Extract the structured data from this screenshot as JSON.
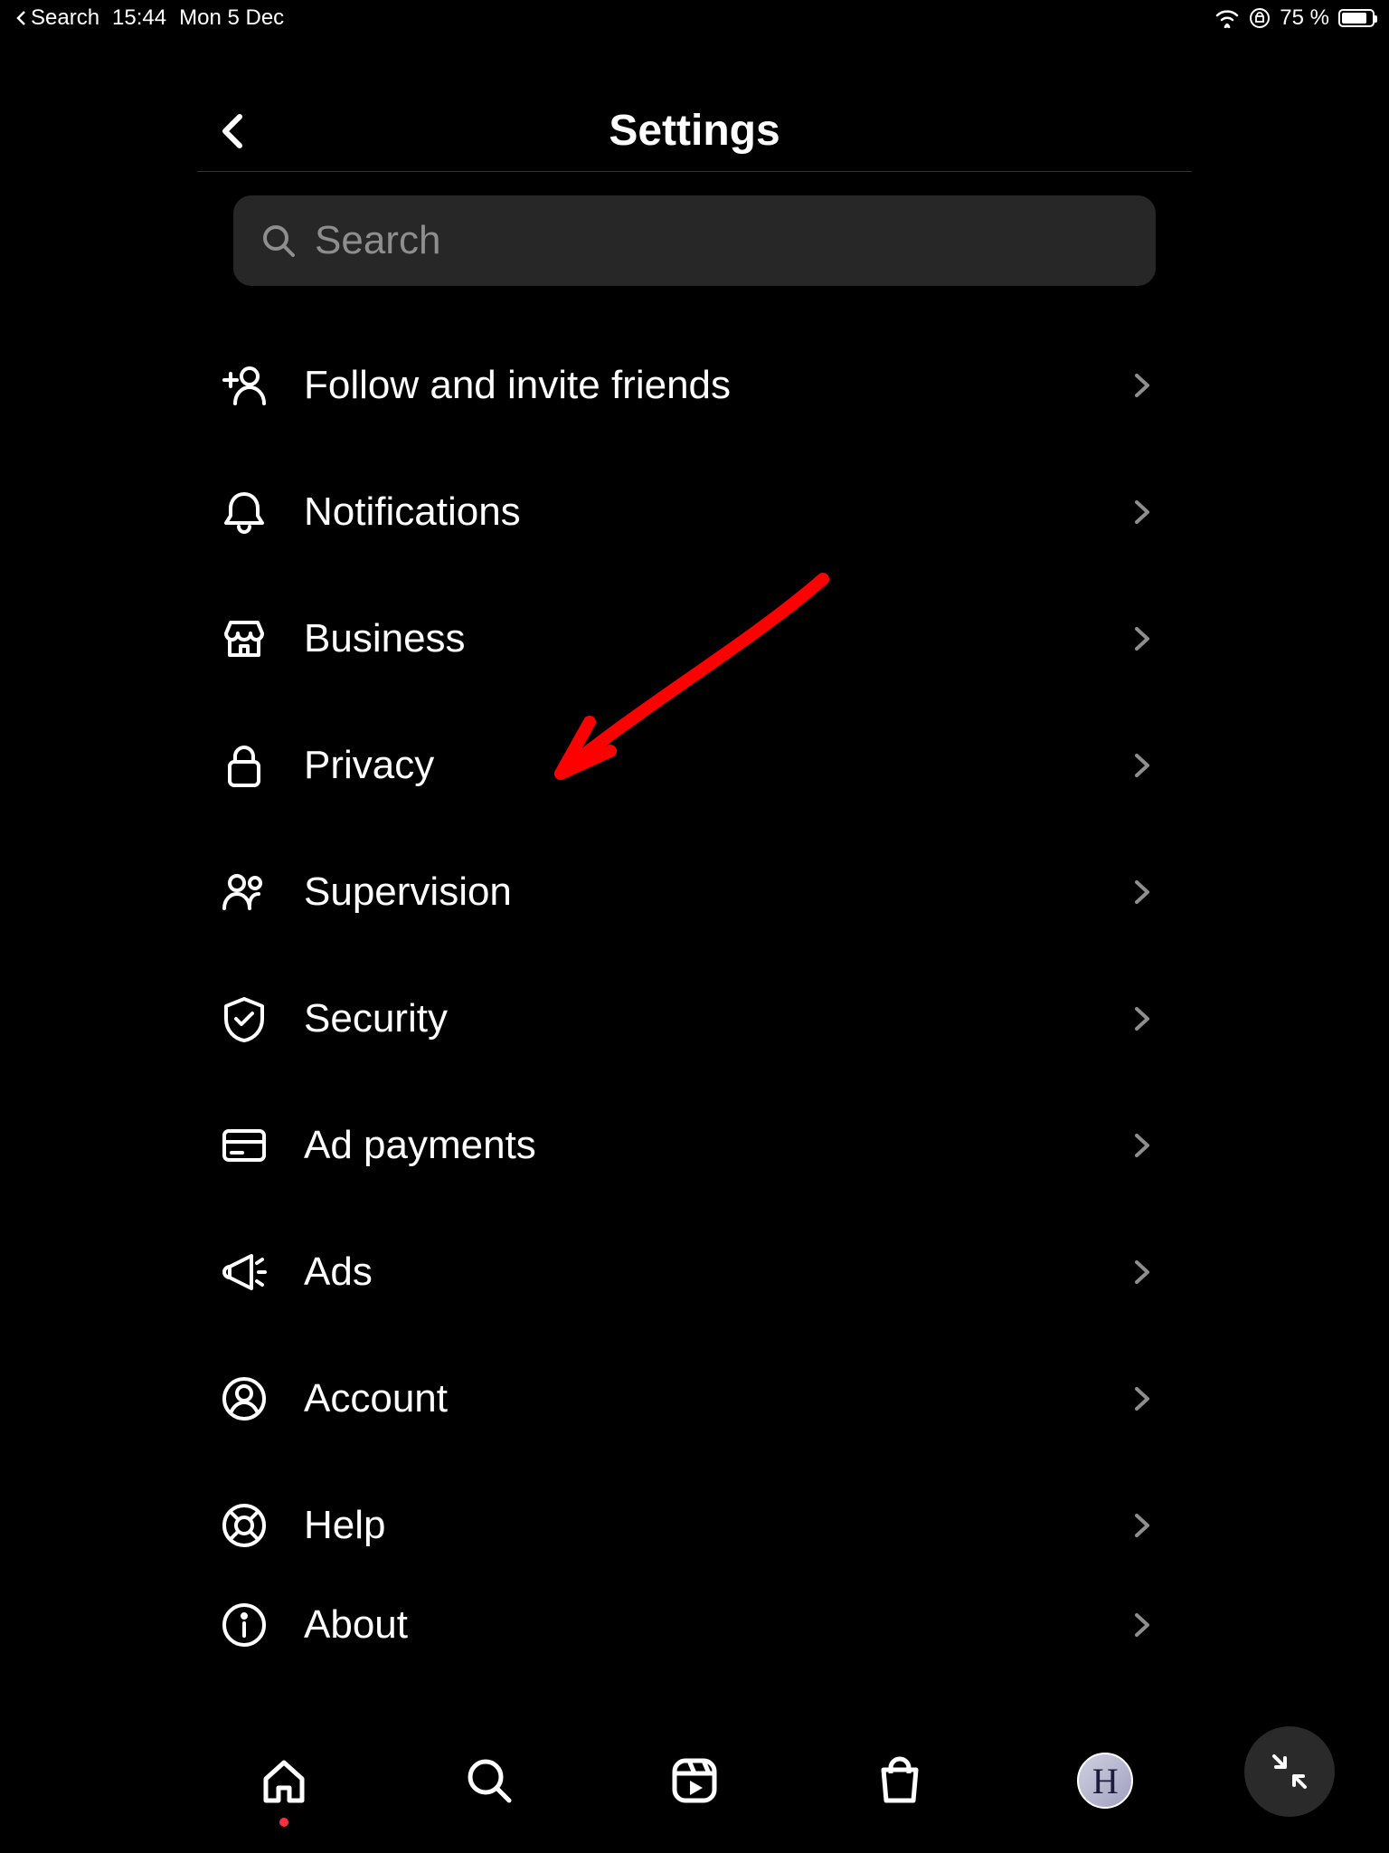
{
  "status_bar": {
    "back_app": "Search",
    "time": "15:44",
    "date": "Mon 5 Dec",
    "battery_percent": "75 %"
  },
  "header": {
    "title": "Settings"
  },
  "search": {
    "placeholder": "Search"
  },
  "menu": {
    "items": [
      {
        "label": "Follow and invite friends",
        "icon": "add-person-icon"
      },
      {
        "label": "Notifications",
        "icon": "bell-icon"
      },
      {
        "label": "Business",
        "icon": "storefront-icon"
      },
      {
        "label": "Privacy",
        "icon": "lock-icon"
      },
      {
        "label": "Supervision",
        "icon": "family-icon"
      },
      {
        "label": "Security",
        "icon": "shield-check-icon"
      },
      {
        "label": "Ad payments",
        "icon": "card-icon"
      },
      {
        "label": "Ads",
        "icon": "megaphone-icon"
      },
      {
        "label": "Account",
        "icon": "account-icon"
      },
      {
        "label": "Help",
        "icon": "lifebuoy-icon"
      },
      {
        "label": "About",
        "icon": "info-icon"
      }
    ]
  },
  "tabs": {
    "profile_initial": "H"
  },
  "annotation": {
    "target": "Privacy",
    "color": "#ff0000"
  }
}
